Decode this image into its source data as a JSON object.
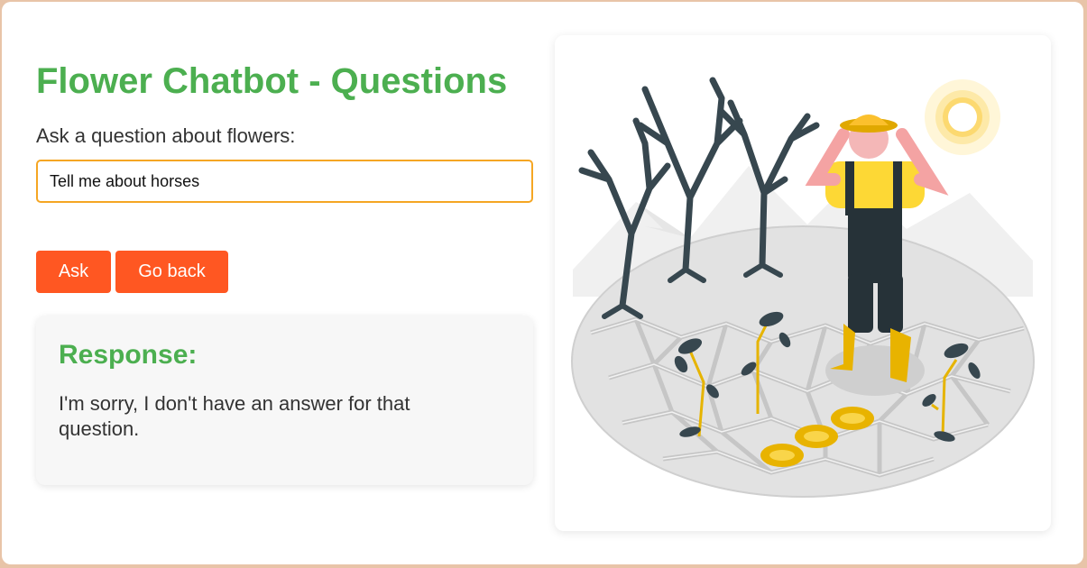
{
  "page": {
    "title": "Flower Chatbot - Questions",
    "prompt_label": "Ask a question about flowers:"
  },
  "question_input": {
    "value": "Tell me about horses"
  },
  "buttons": {
    "ask_label": "Ask",
    "back_label": "Go back"
  },
  "response": {
    "heading": "Response:",
    "text": "I'm sorry, I don't have an answer for that question."
  },
  "illustration": {
    "subject": "farmer-with-dead-plants-drought"
  },
  "colors": {
    "title_green": "#4caf50",
    "button_orange": "#ff5722",
    "input_border": "#f5a623",
    "page_background": "#e8c4a8"
  }
}
